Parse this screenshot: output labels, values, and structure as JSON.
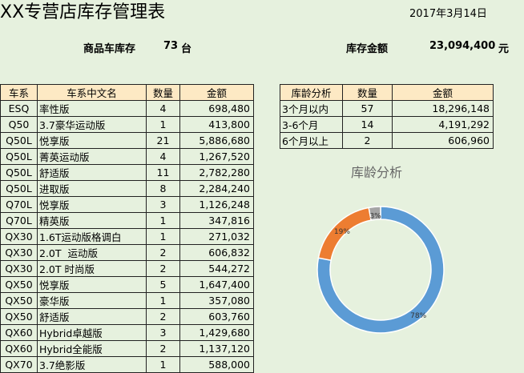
{
  "title": "XX专营店库存管理表",
  "date": "2017年3月14日",
  "summary": {
    "stock_label": "商品车库存",
    "stock_value": "73",
    "stock_unit": "台",
    "amount_label": "库存金额",
    "amount_value": "23,094,400",
    "amount_unit": "元"
  },
  "inventory": {
    "headers": [
      "车系",
      "车系中文名",
      "数量",
      "金额"
    ],
    "rows": [
      [
        "ESQ",
        "率性版",
        "4",
        "698,480"
      ],
      [
        "Q50",
        "3.7豪华运动版",
        "1",
        "413,800"
      ],
      [
        "Q50L",
        "悦享版",
        "21",
        "5,886,680"
      ],
      [
        "Q50L",
        "菁英运动版",
        "4",
        "1,267,520"
      ],
      [
        "Q50L",
        "舒适版",
        "11",
        "2,782,280"
      ],
      [
        "Q50L",
        "进取版",
        "8",
        "2,284,240"
      ],
      [
        "Q70L",
        "悦享版",
        "3",
        "1,126,248"
      ],
      [
        "Q70L",
        "精英版",
        "1",
        "347,816"
      ],
      [
        "QX30",
        "1.6T运动版格调白",
        "1",
        "271,032"
      ],
      [
        "QX30",
        "2.0T  运动版",
        "2",
        "606,832"
      ],
      [
        "QX30",
        "2.0T 时尚版",
        "2",
        "544,272"
      ],
      [
        "QX50",
        "悦享版",
        "5",
        "1,647,400"
      ],
      [
        "QX50",
        "豪华版",
        "1",
        "357,080"
      ],
      [
        "QX50",
        "舒适版",
        "2",
        "603,760"
      ],
      [
        "QX60",
        "Hybrid卓越版",
        "3",
        "1,429,680"
      ],
      [
        "QX60",
        "Hybrid全能版",
        "2",
        "1,137,120"
      ],
      [
        "QX70",
        "3.7绝影版",
        "1",
        "588,000"
      ]
    ]
  },
  "aging": {
    "headers": [
      "库龄分析",
      "数量",
      "金额"
    ],
    "rows": [
      [
        "3个月以内",
        "57",
        "18,296,148"
      ],
      [
        "3-6个月",
        "14",
        "4,191,292"
      ],
      [
        "6个月以上",
        "2",
        "606,960"
      ]
    ]
  },
  "chart_data": {
    "type": "pie",
    "title": "库龄分析",
    "categories": [
      "3个月以内",
      "3-6个月",
      "6个月以上"
    ],
    "values": [
      78,
      19,
      3
    ],
    "labels": [
      "78%",
      "19%",
      "3%"
    ],
    "colors": [
      "#5b9bd5",
      "#ed7d31",
      "#a5a5a5"
    ]
  }
}
